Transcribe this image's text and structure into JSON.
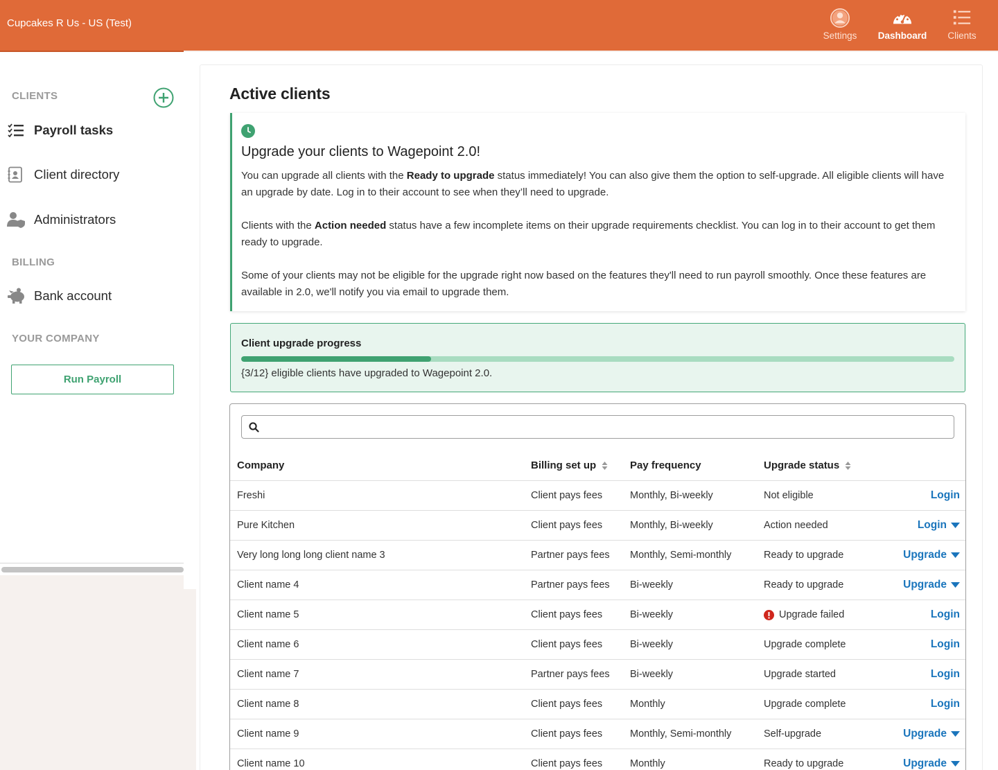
{
  "app": {
    "company_name": "Cupcakes R Us - US (Test)",
    "nav": [
      {
        "label": "Settings",
        "icon": "user-circle-icon"
      },
      {
        "label": "Dashboard",
        "icon": "speedometer-icon",
        "active": true
      },
      {
        "label": "Clients",
        "icon": "list-icon"
      }
    ]
  },
  "sidebar": {
    "clients_label": "CLIENTS",
    "clients_items": [
      {
        "label": "Payroll tasks",
        "icon": "checklist-icon",
        "active": true
      },
      {
        "label": "Client directory",
        "icon": "contact-book-icon"
      },
      {
        "label": "Administrators",
        "icon": "admin-user-icon"
      }
    ],
    "billing_label": "BILLING",
    "billing_items": [
      {
        "label": "Bank account",
        "icon": "piggy-bank-icon"
      }
    ],
    "company_label": "YOUR COMPANY",
    "run_payroll": "Run Payroll"
  },
  "main": {
    "title": "Active clients",
    "notice": {
      "heading": "Upgrade your clients to Wagepoint 2.0!",
      "p1_a": "You can upgrade all clients with the ",
      "p1_b": "Ready to upgrade",
      "p1_c": " status immediately! You can also give them the option to self-upgrade. All eligible clients will have an upgrade by date. Log in to their account to see when they’ll need to upgrade.",
      "p2_a": "Clients with the ",
      "p2_b": "Action needed",
      "p2_c": " status have a few incomplete items on their upgrade requirements checklist. You can log in to their account to get them ready to upgrade.",
      "p3": "Some of your clients may not be eligible for the upgrade right now based on the features they'll need to run payroll smoothly. Once these features are available in 2.0, we'll notify you via email to upgrade them."
    },
    "progress": {
      "title": "Client upgrade progress",
      "fraction": 0.266,
      "text": "{3/12} eligible clients have upgraded to Wagepoint 2.0."
    },
    "search": {
      "value": "",
      "placeholder": ""
    },
    "table": {
      "headers": {
        "company": "Company",
        "billing": "Billing set up",
        "frequency": "Pay frequency",
        "status": "Upgrade status"
      },
      "rows": [
        {
          "company": "Freshi",
          "billing": "Client pays fees",
          "frequency": "Monthly, Bi-weekly",
          "status": "Not eligible",
          "action": "Login",
          "dropdown": false,
          "error": false
        },
        {
          "company": "Pure Kitchen",
          "billing": "Client pays fees",
          "frequency": "Monthly, Bi-weekly",
          "status": "Action needed",
          "action": "Login",
          "dropdown": true,
          "error": false
        },
        {
          "company": "Very long long long client name 3",
          "billing": "Partner pays fees",
          "frequency": "Monthly, Semi-monthly",
          "status": "Ready to upgrade",
          "action": "Upgrade",
          "dropdown": true,
          "error": false
        },
        {
          "company": "Client name 4",
          "billing": "Partner pays fees",
          "frequency": "Bi-weekly",
          "status": "Ready to upgrade",
          "action": "Upgrade",
          "dropdown": true,
          "error": false
        },
        {
          "company": "Client name 5",
          "billing": "Client pays fees",
          "frequency": "Bi-weekly",
          "status": "Upgrade failed",
          "action": "Login",
          "dropdown": false,
          "error": true
        },
        {
          "company": "Client name 6",
          "billing": "Client pays fees",
          "frequency": "Bi-weekly",
          "status": "Upgrade complete",
          "action": "Login",
          "dropdown": false,
          "error": false
        },
        {
          "company": "Client name 7",
          "billing": "Partner pays fees",
          "frequency": "Bi-weekly",
          "status": "Upgrade started",
          "action": "Login",
          "dropdown": false,
          "error": false
        },
        {
          "company": "Client name 8",
          "billing": "Client pays fees",
          "frequency": "Monthly",
          "status": "Upgrade complete",
          "action": "Login",
          "dropdown": false,
          "error": false
        },
        {
          "company": "Client name 9",
          "billing": "Client pays fees",
          "frequency": "Monthly, Semi-monthly",
          "status": "Self-upgrade",
          "action": "Upgrade",
          "dropdown": true,
          "error": false
        },
        {
          "company": "Client name 10",
          "billing": "Client pays fees",
          "frequency": "Monthly",
          "status": "Ready to upgrade",
          "action": "Upgrade",
          "dropdown": true,
          "error": false
        }
      ]
    }
  },
  "colors": {
    "brand": "#e06a38",
    "accent_green": "#3fa271",
    "link_blue": "#1a75bc",
    "error_red": "#d0271d"
  }
}
